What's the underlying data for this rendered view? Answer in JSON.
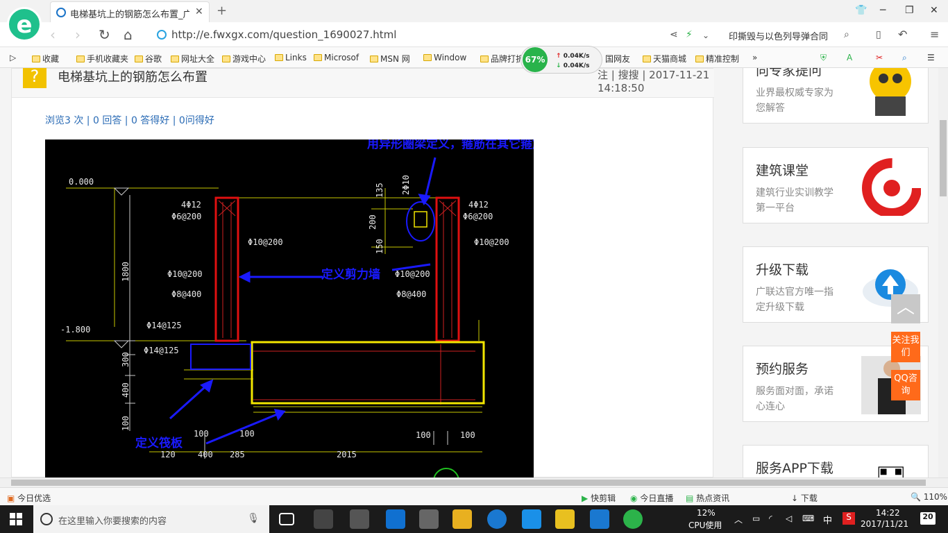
{
  "browser": {
    "tab_title": "电梯基坑上的钢筋怎么布置_广联",
    "url": "http://e.fwxgx.com/question_1690027.html",
    "search_text": "印撕毁与以色列导弹合同"
  },
  "bookmarks": [
    "收藏",
    "手机收藏夹",
    "谷歌",
    "网址大全",
    "游戏中心",
    "Links",
    "Microsof",
    "MSN 网",
    "Window",
    "品牌打折",
    "国网友",
    "天猫商城",
    "精准控制"
  ],
  "net_widget": {
    "percent": "67%",
    "up": "0.04K/s",
    "down": "0.04K/s"
  },
  "question": {
    "title": "电梯基坑上的钢筋怎么布置",
    "meta": "注 | 搜搜 | 2017-11-21 14:18:50",
    "stats": "浏览3 次 | 0 回答 | 0 答得好 | 0问得好"
  },
  "cad": {
    "annotation_top": "用异形圈梁定义，箍筋在其它箍筋在输入",
    "annotation_wall": "定义剪力墙",
    "annotation_slab": "定义筏板",
    "labels": {
      "elev1": "0.000",
      "elev2": "-1.800",
      "rebar1": "4Φ12",
      "rebar2": "Φ6@200",
      "rebar3": "Φ10@200",
      "rebar4": "Φ10@200",
      "rebar5": "Φ8@400",
      "rebar6": "Φ14@125",
      "rebar7": "Φ14@125",
      "rebar8": "4Φ12",
      "rebar9": "Φ6@200",
      "rebar10": "Φ10@200",
      "rebar11": "Φ10@200",
      "rebar12": "Φ8@400",
      "d1800": "1800",
      "d300": "300",
      "d400": "400",
      "d100": "100",
      "d135": "135",
      "d200": "200",
      "d150": "150",
      "d2phi10": "2Φ10",
      "b100a": "100",
      "b100b": "100",
      "b100c": "100",
      "b100d": "100",
      "b120": "120",
      "b400": "400",
      "b285": "285",
      "b2015": "2015"
    }
  },
  "sidebar": {
    "cards": [
      {
        "title": "向专家提问",
        "desc": "业界最权威专家为您解答"
      },
      {
        "title": "建筑课堂",
        "desc": "建筑行业实训教学第一平台"
      },
      {
        "title": "升级下载",
        "desc": "广联达官方唯一指定升级下载"
      },
      {
        "title": "预约服务",
        "desc": "服务面对面，承诺心连心"
      },
      {
        "title": "服务APP下载",
        "desc": ""
      }
    ],
    "follow_btn": "关注我们",
    "qq_btn": "QQ咨询"
  },
  "status": {
    "left": "今日优选",
    "items": [
      "快剪辑",
      "今日直播",
      "热点资讯",
      "下载"
    ],
    "zoom": "110%"
  },
  "taskbar": {
    "search_placeholder": "在这里输入你要搜索的内容",
    "cpu_percent": "12%",
    "cpu_label": "CPU使用",
    "ime": "中",
    "time": "14:22",
    "date": "2017/11/21",
    "notif_count": "20"
  }
}
